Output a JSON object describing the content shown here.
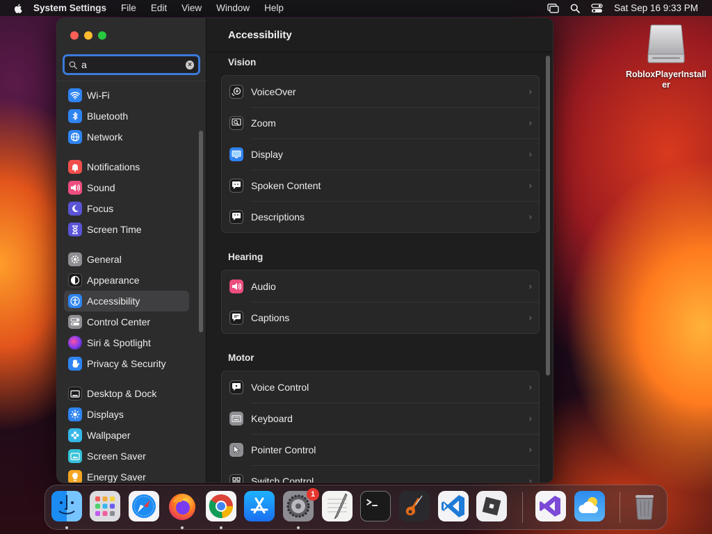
{
  "menubar": {
    "app_name": "System Settings",
    "items": [
      "File",
      "Edit",
      "View",
      "Window",
      "Help"
    ],
    "clock": "Sat Sep 16  9:33 PM"
  },
  "desktop": {
    "icon_label": "RobloxPlayerInstaller"
  },
  "window": {
    "search": {
      "value": "a"
    },
    "sidebar": {
      "selected": "Accessibility",
      "groups": [
        [
          "Wi-Fi",
          "Bluetooth",
          "Network"
        ],
        [
          "Notifications",
          "Sound",
          "Focus",
          "Screen Time"
        ],
        [
          "General",
          "Appearance",
          "Accessibility",
          "Control Center",
          "Siri & Spotlight",
          "Privacy & Security"
        ],
        [
          "Desktop & Dock",
          "Displays",
          "Wallpaper",
          "Screen Saver",
          "Energy Saver"
        ]
      ]
    },
    "content": {
      "title": "Accessibility",
      "sections": [
        {
          "label": "Vision",
          "rows": [
            "VoiceOver",
            "Zoom",
            "Display",
            "Spoken Content",
            "Descriptions"
          ]
        },
        {
          "label": "Hearing",
          "rows": [
            "Audio",
            "Captions"
          ]
        },
        {
          "label": "Motor",
          "rows": [
            "Voice Control",
            "Keyboard",
            "Pointer Control",
            "Switch Control"
          ]
        }
      ]
    }
  },
  "dock": {
    "badge_count": "1"
  },
  "icons": {
    "sidebar": [
      "wifi-icon",
      "bluetooth-icon",
      "network-globe-icon",
      "notifications-bell-icon",
      "sound-speaker-icon",
      "focus-moon-icon",
      "screen-time-hourglass-icon",
      "general-gear-icon",
      "appearance-icon",
      "accessibility-icon",
      "control-center-icon",
      "siri-icon",
      "privacy-hand-icon",
      "desktop-dock-icon",
      "displays-sun-icon",
      "wallpaper-flower-icon",
      "screen-saver-icon",
      "energy-saver-bulb-icon"
    ],
    "content": [
      "voiceover-icon",
      "zoom-icon",
      "display-icon",
      "spoken-content-icon",
      "descriptions-icon",
      "audio-icon",
      "captions-icon",
      "voice-control-icon",
      "keyboard-icon",
      "pointer-control-icon",
      "switch-control-icon"
    ]
  },
  "colors": {
    "accent": "#3a7ad9",
    "close": "#ff5f57",
    "minimize": "#febc2e",
    "zoom": "#28c840"
  }
}
